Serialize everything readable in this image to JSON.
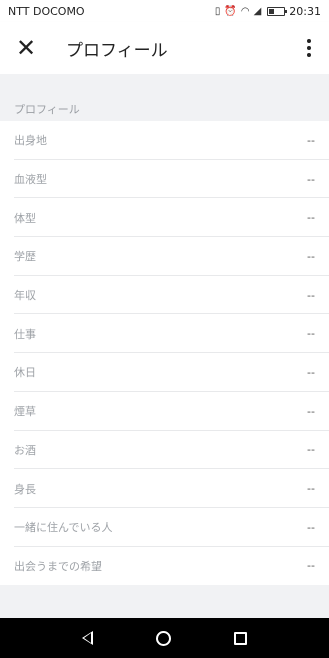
{
  "status_bar": {
    "carrier": "NTT DOCOMO",
    "time": "20:31",
    "icons": [
      "vibrate-icon",
      "alarm-icon",
      "wifi-icon",
      "signal-icon",
      "battery-icon"
    ]
  },
  "app_bar": {
    "close_icon": "close-icon",
    "title": "プロフィール",
    "menu_icon": "more-vert-icon"
  },
  "section": {
    "header": "プロフィール",
    "rows": [
      {
        "label": "出身地",
        "value": "--"
      },
      {
        "label": "血液型",
        "value": "--"
      },
      {
        "label": "体型",
        "value": "--"
      },
      {
        "label": "学歴",
        "value": "--"
      },
      {
        "label": "年収",
        "value": "--"
      },
      {
        "label": "仕事",
        "value": "--"
      },
      {
        "label": "休日",
        "value": "--"
      },
      {
        "label": "煙草",
        "value": "--"
      },
      {
        "label": "お酒",
        "value": "--"
      },
      {
        "label": "身長",
        "value": "--"
      },
      {
        "label": "一緒に住んでいる人",
        "value": "--"
      },
      {
        "label": "出会うまでの希望",
        "value": "--"
      }
    ]
  },
  "nav_bar": {
    "icons": [
      "back-icon",
      "home-icon",
      "recent-apps-icon"
    ]
  },
  "colors": {
    "background": "#f1f2f4",
    "surface": "#ffffff",
    "label": "#9ea2a7",
    "divider": "#e8e9eb",
    "nav": "#000000"
  }
}
